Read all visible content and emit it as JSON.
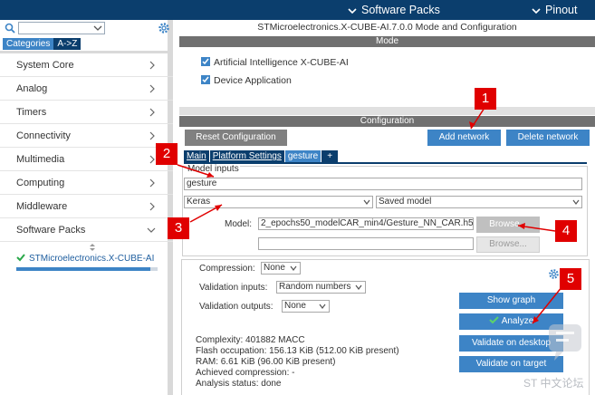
{
  "topbar": {
    "software_packs": "Software Packs",
    "pinout": "Pinout"
  },
  "left": {
    "tabs": [
      "Categories",
      "A->Z"
    ],
    "categories": [
      "System Core",
      "Analog",
      "Timers",
      "Connectivity",
      "Multimedia",
      "Computing",
      "Middleware",
      "Software Packs"
    ],
    "pack_name": "STMicroelectronics.X-CUBE-AI",
    "pack_progress": 0.95
  },
  "main": {
    "subtitle": "STMicroelectronics.X-CUBE-AI.7.0.0 Mode and Configuration",
    "mode_header": "Mode",
    "mode_items": [
      "Artificial Intelligence X-CUBE-AI",
      "Device Application"
    ],
    "config_header": "Configuration",
    "reset_button": "Reset Configuration",
    "add_network_button": "Add network",
    "delete_network_button": "Delete network",
    "tabs": [
      "Main",
      "Platform Settings",
      "gesture",
      "+"
    ],
    "model_inputs_label": "Model inputs",
    "model_name": "gesture",
    "framework": "Keras",
    "model_type": "Saved model",
    "model_label": "Model:",
    "model_path": "2_epochs50_modelCAR_min4/Gesture_NN_CAR.h5",
    "browse_button": "Browse...",
    "browse_button2": "Browse...",
    "compression_label": "Compression:",
    "compression_value": "None",
    "validation_inputs_label": "Validation inputs:",
    "validation_inputs_value": "Random numbers",
    "validation_outputs_label": "Validation outputs:",
    "validation_outputs_value": "None",
    "show_graph_button": "Show graph",
    "analyze_button": "Analyze",
    "validate_desktop_button": "Validate on desktop",
    "validate_target_button": "Validate on target",
    "complexity": "Complexity:  401882 MACC",
    "flash": "Flash occupation: 156.13 KiB (512.00 KiB present)",
    "ram": "RAM: 6.61 KiB (96.00 KiB present)",
    "achieved_compression": "Achieved compression: -",
    "analysis_status": "Analysis status: done"
  },
  "annotations": [
    "1",
    "2",
    "3",
    "4",
    "5"
  ],
  "watermark": "ST 中文论坛",
  "colors": {
    "navy": "#0b3e6d",
    "accent": "#3d84c6",
    "annotation": "#e00000"
  }
}
